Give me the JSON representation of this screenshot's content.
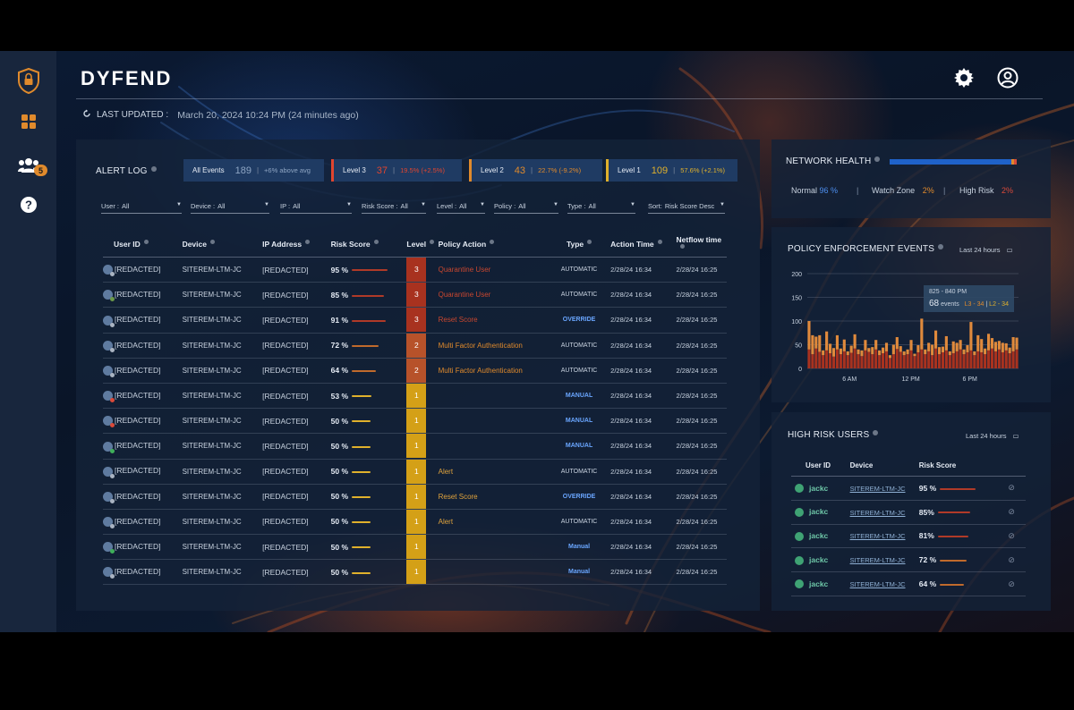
{
  "app": {
    "logo": "DYFEND",
    "sidebar_badge": "5"
  },
  "header": {
    "last_updated_label": "LAST UPDATED :",
    "last_updated_value": "March 20, 2024 10:24 PM  (24 minutes ago)"
  },
  "alert_log": {
    "title": "ALERT LOG",
    "stats": [
      {
        "label": "All Events",
        "value": "189",
        "change": "+6% above avg",
        "color": "#8fa6c4"
      },
      {
        "label": "Level 3",
        "value": "37",
        "change": "19.5% (+2.5%)",
        "color": "#e0452f"
      },
      {
        "label": "Level 2",
        "value": "43",
        "change": "22.7% (-9.2%)",
        "color": "#e08a2c"
      },
      {
        "label": "Level 1",
        "value": "109",
        "change": "57.6% (+2.1%)",
        "color": "#e0b12c"
      }
    ],
    "filters": [
      {
        "label": "User :",
        "value": "All"
      },
      {
        "label": "Device :",
        "value": "All"
      },
      {
        "label": "IP :",
        "value": "All"
      },
      {
        "label": "Risk Score :",
        "value": "All"
      },
      {
        "label": "Level :",
        "value": "All"
      },
      {
        "label": "Policy :",
        "value": "All"
      },
      {
        "label": "Type :",
        "value": "All"
      },
      {
        "label": "Sort:",
        "value": "Risk Score Desc"
      }
    ],
    "columns": [
      "User ID",
      "Device",
      "IP Address",
      "Risk Score",
      "Level",
      "Policy Action",
      "Type",
      "Action Time",
      "Netflow time"
    ],
    "rows": [
      {
        "user": "[REDACTED]",
        "device": "SITEREM-LTM-JC",
        "ip": "[REDACTED]",
        "risk": "95 %",
        "risk_pct": 95,
        "level": "3",
        "policy": "Quarantine User",
        "type": "AUTOMATIC",
        "action_time": "2/28/24 16:34",
        "netflow_time": "2/28/24 16:25",
        "status": "#aab4c2"
      },
      {
        "user": "[REDACTED]",
        "device": "SITEREM-LTM-JC",
        "ip": "[REDACTED]",
        "risk": "85 %",
        "risk_pct": 85,
        "level": "3",
        "policy": "Quarantine User",
        "type": "AUTOMATIC",
        "action_time": "2/28/24 16:34",
        "netflow_time": "2/28/24 16:25",
        "status": "#6c9a4a"
      },
      {
        "user": "[REDACTED]",
        "device": "SITEREM-LTM-JC",
        "ip": "[REDACTED]",
        "risk": "91 %",
        "risk_pct": 91,
        "level": "3",
        "policy": "Reset Score",
        "type": "OVERRIDE",
        "action_time": "2/28/24 16:34",
        "netflow_time": "2/28/24 16:25",
        "status": "#aab4c2"
      },
      {
        "user": "[REDACTED]",
        "device": "SITEREM-LTM-JC",
        "ip": "[REDACTED]",
        "risk": "72 %",
        "risk_pct": 72,
        "level": "2",
        "policy": "Multi Factor Authentication",
        "type": "AUTOMATIC",
        "action_time": "2/28/24 16:34",
        "netflow_time": "2/28/24 16:25",
        "status": "#aab4c2"
      },
      {
        "user": "[REDACTED]",
        "device": "SITEREM-LTM-JC",
        "ip": "[REDACTED]",
        "risk": "64 %",
        "risk_pct": 64,
        "level": "2",
        "policy": "Multi Factor Authentication",
        "type": "AUTOMATIC",
        "action_time": "2/28/24 16:34",
        "netflow_time": "2/28/24 16:25",
        "status": "#aab4c2"
      },
      {
        "user": "[REDACTED]",
        "device": "SITEREM-LTM-JC",
        "ip": "[REDACTED]",
        "risk": "53 %",
        "risk_pct": 53,
        "level": "1",
        "policy": "",
        "type": "MANUAL",
        "action_time": "2/28/24 16:34",
        "netflow_time": "2/28/24 16:25",
        "status": "#d94a3a"
      },
      {
        "user": "[REDACTED]",
        "device": "SITEREM-LTM-JC",
        "ip": "[REDACTED]",
        "risk": "50 %",
        "risk_pct": 50,
        "level": "1",
        "policy": "",
        "type": "MANUAL",
        "action_time": "2/28/24 16:34",
        "netflow_time": "2/28/24 16:25",
        "status": "#d94a3a"
      },
      {
        "user": "[REDACTED]",
        "device": "SITEREM-LTM-JC",
        "ip": "[REDACTED]",
        "risk": "50 %",
        "risk_pct": 50,
        "level": "1",
        "policy": "",
        "type": "MANUAL",
        "action_time": "2/28/24 16:34",
        "netflow_time": "2/28/24 16:25",
        "status": "#3fb05a"
      },
      {
        "user": "[REDACTED]",
        "device": "SITEREM-LTM-JC",
        "ip": "[REDACTED]",
        "risk": "50 %",
        "risk_pct": 50,
        "level": "1",
        "policy": "Alert",
        "type": "AUTOMATIC",
        "action_time": "2/28/24 16:34",
        "netflow_time": "2/28/24 16:25",
        "status": "#aab4c2"
      },
      {
        "user": "[REDACTED]",
        "device": "SITEREM-LTM-JC",
        "ip": "[REDACTED]",
        "risk": "50 %",
        "risk_pct": 50,
        "level": "1",
        "policy": "Reset Score",
        "type": "OVERRIDE",
        "action_time": "2/28/24 16:34",
        "netflow_time": "2/28/24 16:25",
        "status": "#aab4c2"
      },
      {
        "user": "[REDACTED]",
        "device": "SITEREM-LTM-JC",
        "ip": "[REDACTED]",
        "risk": "50 %",
        "risk_pct": 50,
        "level": "1",
        "policy": "Alert",
        "type": "AUTOMATIC",
        "action_time": "2/28/24 16:34",
        "netflow_time": "2/28/24 16:25",
        "status": "#aab4c2"
      },
      {
        "user": "[REDACTED]",
        "device": "SITEREM-LTM-JC",
        "ip": "[REDACTED]",
        "risk": "50 %",
        "risk_pct": 50,
        "level": "1",
        "policy": "",
        "type": "Manual",
        "action_time": "2/28/24 16:34",
        "netflow_time": "2/28/24 16:25",
        "status": "#3fb05a"
      },
      {
        "user": "[REDACTED]",
        "device": "SITEREM-LTM-JC",
        "ip": "[REDACTED]",
        "risk": "50 %",
        "risk_pct": 50,
        "level": "1",
        "policy": "",
        "type": "Manual",
        "action_time": "2/28/24 16:34",
        "netflow_time": "2/28/24 16:25",
        "status": "#aab4c2"
      }
    ]
  },
  "network_health": {
    "title": "NETWORK HEALTH",
    "normal_label": "Normal",
    "normal_value": "96 %",
    "watch_label": "Watch Zone",
    "watch_value": "2%",
    "high_label": "High Risk",
    "high_value": "2%",
    "normal_pct": 96,
    "watch_pct": 2,
    "high_pct": 2
  },
  "policy_events": {
    "title": "POLICY ENFORCEMENT EVENTS",
    "range_label": "Last 24 hours",
    "tooltip": {
      "time": "825 - 840 PM",
      "count": "68",
      "events_label": "events",
      "l3": "L3 - 34",
      "l2": "L2 - 34"
    },
    "chart_data": {
      "type": "bar",
      "stacked": true,
      "ylim": [
        0,
        200
      ],
      "yticks": [
        "200",
        "150",
        "100",
        "50",
        "0"
      ],
      "xticks": [
        "6 AM",
        "12 PM",
        "6 PM"
      ],
      "series": [
        {
          "name": "L3",
          "color": "#a8321f",
          "values": [
            40,
            30,
            42,
            35,
            28,
            38,
            32,
            25,
            40,
            30,
            36,
            28,
            33,
            42,
            30,
            26,
            38,
            35,
            30,
            40,
            28,
            32,
            36,
            22,
            30,
            41,
            35,
            28,
            30,
            38,
            26,
            34,
            40,
            30,
            36,
            28,
            42,
            30,
            34,
            38,
            28,
            32,
            36,
            40,
            30,
            34,
            38,
            28,
            36,
            34,
            30,
            38,
            42,
            36,
            40,
            34,
            38,
            32,
            36,
            40
          ]
        },
        {
          "name": "L2",
          "color": "#e08a3c",
          "values": [
            60,
            40,
            25,
            35,
            10,
            40,
            20,
            18,
            30,
            12,
            25,
            8,
            15,
            30,
            10,
            12,
            22,
            8,
            15,
            20,
            10,
            12,
            18,
            6,
            20,
            25,
            12,
            8,
            10,
            22,
            5,
            15,
            65,
            10,
            18,
            22,
            38,
            15,
            12,
            30,
            8,
            25,
            18,
            20,
            10,
            15,
            60,
            8,
            34,
            28,
            12,
            35,
            22,
            20,
            18,
            20,
            15,
            12,
            30,
            25
          ]
        }
      ]
    }
  },
  "high_risk": {
    "title": "HIGH RISK USERS",
    "range_label": "Last 24 hours",
    "columns": [
      "User ID",
      "Device",
      "Risk Score"
    ],
    "rows": [
      {
        "user": "jackc",
        "device": "SITEREM-LTM-JC",
        "risk": "95 %",
        "risk_pct": 95
      },
      {
        "user": "jackc",
        "device": "SITEREM-LTM-JC",
        "risk": "85%",
        "risk_pct": 85
      },
      {
        "user": "jackc",
        "device": "SITEREM-LTM-JC",
        "risk": "81%",
        "risk_pct": 81
      },
      {
        "user": "jackc",
        "device": "SITEREM-LTM-JC",
        "risk": "72 %",
        "risk_pct": 72
      },
      {
        "user": "jackc",
        "device": "SITEREM-LTM-JC",
        "risk": "64 %",
        "risk_pct": 64
      }
    ]
  },
  "colors": {
    "level3": "#a8321f",
    "level2": "#b7522a",
    "level1": "#d4a017",
    "accent": "#1f62c9"
  }
}
